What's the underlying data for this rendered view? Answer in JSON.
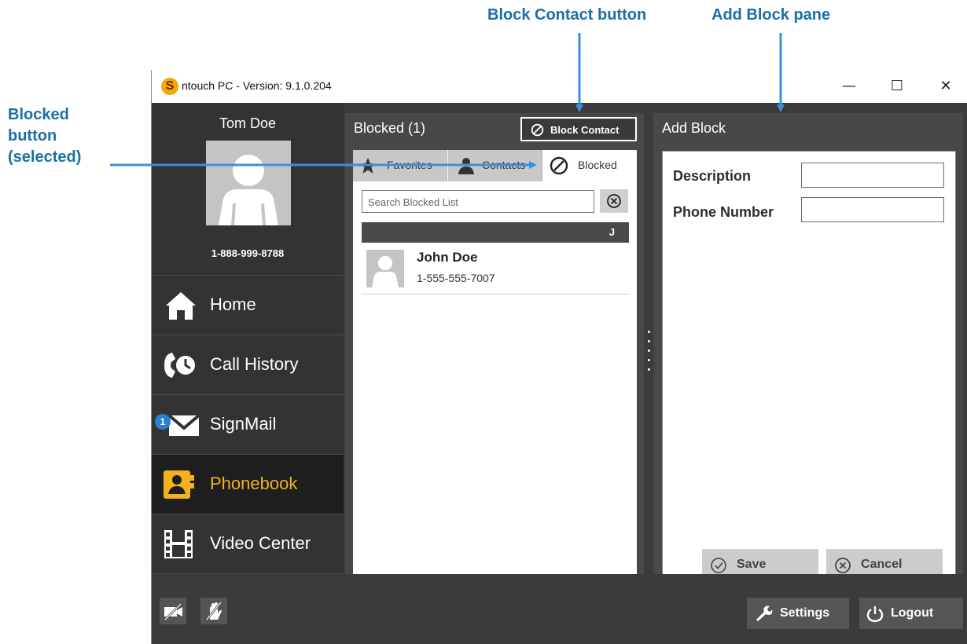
{
  "callouts": {
    "block_contact_button": "Block Contact button",
    "add_block_pane": "Add Block pane",
    "blocked_button": "Blocked button (selected)"
  },
  "window": {
    "title": "ntouch PC  -  Version:  9.1.0.204",
    "logo_letter": "S",
    "controls": {
      "minimize": "—",
      "maximize": "☐",
      "close": "✕"
    }
  },
  "profile": {
    "name": "Tom Doe",
    "phone": "1-888-999-8788"
  },
  "nav": {
    "items": [
      {
        "label": "Home",
        "icon": "home-icon",
        "selected": false
      },
      {
        "label": "Call History",
        "icon": "call-history-icon",
        "selected": false
      },
      {
        "label": "SignMail",
        "icon": "signmail-icon",
        "badge": "1",
        "selected": false
      },
      {
        "label": "Phonebook",
        "icon": "phonebook-icon",
        "selected": true
      },
      {
        "label": "Video Center",
        "icon": "video-center-icon",
        "selected": false
      }
    ]
  },
  "blocked_panel": {
    "title": "Blocked (1)",
    "block_contact_label": "Block Contact",
    "tabs": [
      "Favorites",
      "Contacts",
      "Blocked"
    ],
    "active_tab": "Blocked",
    "search_placeholder": "Search Blocked List",
    "section_letter": "J",
    "contacts": [
      {
        "name": "John Doe",
        "phone": "1-555-555-7007"
      }
    ]
  },
  "add_block": {
    "title": "Add Block",
    "description_label": "Description",
    "phone_label": "Phone Number",
    "description_value": "",
    "phone_value": "",
    "save_label": "Save",
    "cancel_label": "Cancel"
  },
  "bottom": {
    "settings_label": "Settings",
    "logout_label": "Logout"
  },
  "colors": {
    "accent": "#f3b21b",
    "callout": "#1b6fa6",
    "arrow": "#3b8fe0"
  }
}
